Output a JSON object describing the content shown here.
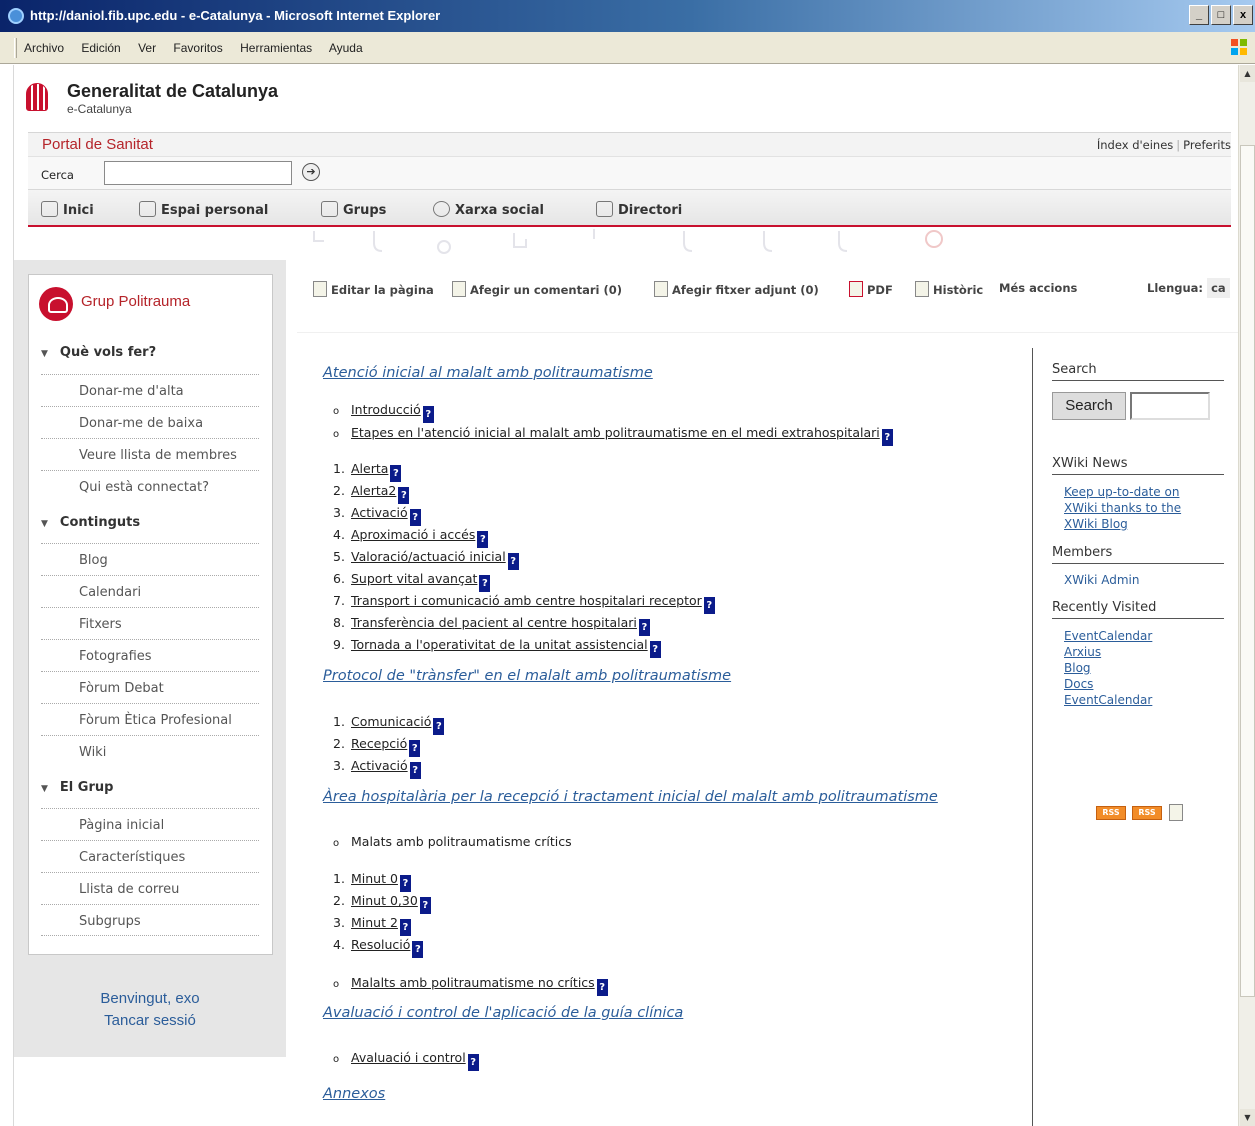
{
  "browser": {
    "title": "http://daniol.fib.upc.edu - e-Catalunya - Microsoft Internet Explorer",
    "window_buttons": [
      "_",
      "□",
      "x"
    ],
    "menu": [
      "Archivo",
      "Edición",
      "Ver",
      "Favoritos",
      "Herramientas",
      "Ayuda"
    ]
  },
  "header": {
    "logo_title": "Generalitat de Catalunya",
    "logo_subtitle": "e-Catalunya",
    "portal_title": "Portal de Sanitat",
    "top_links": [
      "Índex d'eines",
      "Preferits"
    ],
    "search_label": "Cerca",
    "search_value": "",
    "go_symbol": "➔"
  },
  "nav": [
    {
      "label": "Inici",
      "icon": "home-icon"
    },
    {
      "label": "Espai personal",
      "icon": "user-icon"
    },
    {
      "label": "Grups",
      "icon": "group-icon"
    },
    {
      "label": "Xarxa social",
      "icon": "network-icon"
    },
    {
      "label": "Directori",
      "icon": "folder-icon"
    }
  ],
  "sidebar": {
    "group_title": "Grup Politrauma",
    "sections": [
      {
        "title": "Què vols fer?",
        "items": [
          "Donar-me d'alta",
          "Donar-me de baixa",
          "Veure llista de membres",
          "Qui està connectat?"
        ]
      },
      {
        "title": "Continguts",
        "items": [
          "Blog",
          "Calendari",
          "Fitxers",
          "Fotografies",
          "Fòrum Debat",
          "Fòrum Ètica Profesional",
          "Wiki"
        ]
      },
      {
        "title": "El Grup",
        "items": [
          "Pàgina inicial",
          "Característiques",
          "Llista de correu",
          "Subgrups"
        ]
      }
    ],
    "welcome": "Benvingut, exo",
    "logout": "Tancar sessió"
  },
  "actions": [
    {
      "label": "Editar la pàgina",
      "icon": "edit-icon"
    },
    {
      "label": "Afegir un comentari (0)",
      "icon": "comment-icon"
    },
    {
      "label": "Afegir fitxer adjunt (0)",
      "icon": "attach-icon"
    },
    {
      "label": "PDF",
      "icon": "pdf-icon"
    },
    {
      "label": "Històric",
      "icon": "history-icon"
    },
    {
      "label": "Més accions",
      "icon": ""
    }
  ],
  "language": {
    "label": "Llengua:",
    "value": "ca"
  },
  "content": {
    "s1_title": "Atenció inicial al malalt amb politraumatisme",
    "s1_bullets": [
      "Introducció",
      "Etapes en l'atenció inicial al malalt amb politraumatisme en el medi extrahospitalari"
    ],
    "s1_numbered": [
      "Alerta",
      "Alerta2",
      "Activació",
      "Aproximació i accés",
      "Valoració/actuació inicial",
      "Suport vital avançat",
      "Transport i comunicació amb centre hospitalari receptor",
      "Transferència del pacient al centre hospitalari",
      "Tornada a l'operativitat de la unitat assistencial"
    ],
    "s2_title": "Protocol de \"trànsfer\" en el malalt amb politraumatisme",
    "s2_numbered": [
      "Comunicació",
      "Recepció",
      "Activació"
    ],
    "s3_title": "Àrea hospitalària per la recepció i tractament inicial del malalt amb politraumatisme",
    "s3_bullet1": "Malats amb politraumatisme crítics",
    "s3_numbered": [
      "Minut 0",
      "Minut 0,30",
      "Minut 2",
      "Resolució"
    ],
    "s3_bullet2": "Malalts amb politraumatisme no crítics",
    "s4_title": "Avaluació i control de l'aplicació de la guía clínica",
    "s4_bullet": "Avaluació i control",
    "s5_title": "Annexos",
    "qmark": "?",
    "num_markers": [
      "1.",
      "2.",
      "3.",
      "4.",
      "5.",
      "6.",
      "7.",
      "8.",
      "9."
    ],
    "bullet_marker": "o"
  },
  "right_panel": {
    "search_heading": "Search",
    "search_button": "Search",
    "news_heading": "XWiki News",
    "news_link": [
      "Keep up-to-date on",
      "XWiki thanks to the",
      "XWiki Blog"
    ],
    "members_heading": "Members",
    "member": "XWiki Admin",
    "recent_heading": "Recently Visited",
    "recent": [
      "EventCalendar",
      "Arxius",
      "Blog",
      "Docs",
      "EventCalendar"
    ],
    "rss": [
      "RSS",
      "RSS"
    ]
  }
}
